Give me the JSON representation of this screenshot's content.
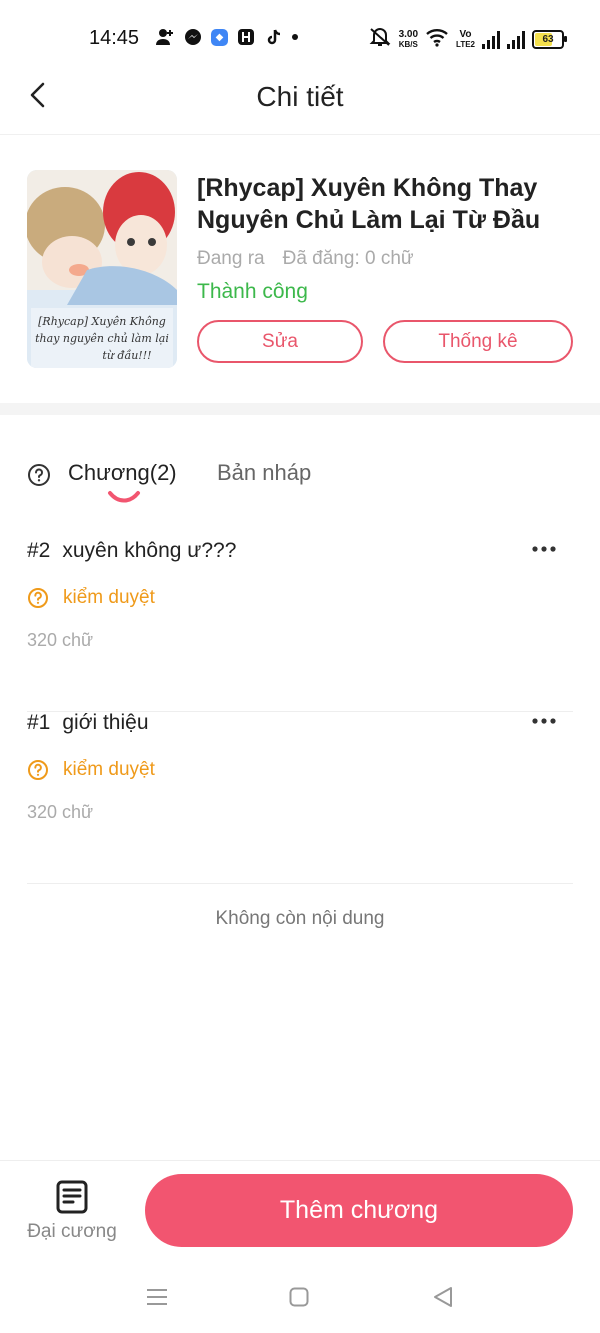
{
  "status_bar": {
    "time": "14:45",
    "net_speed_top": "3.00",
    "net_speed_bottom": "KB/S",
    "volte_top": "Vo",
    "volte_bottom": "LTE2",
    "battery": "63",
    "battery_level": 0.63,
    "icons": [
      "add-user-icon",
      "messenger-icon",
      "app-icon",
      "h-app-icon",
      "tiktok-icon",
      "dot-icon",
      "mute-icon",
      "wifi-icon",
      "signal-icon",
      "signal-icon"
    ]
  },
  "header": {
    "title": "Chi tiết"
  },
  "book": {
    "title": "[Rhycap] Xuyên Không Thay Nguyên Chủ Làm Lại Từ Đầu",
    "status": "Đang ra",
    "posted": "Đã đăng: 0 chữ",
    "result": "Thành công",
    "edit_label": "Sửa",
    "stats_label": "Thống kê",
    "cover_text": [
      "[Rhycap] Xuyên Không",
      "thay nguyên chủ làm lại",
      "từ đầu!!!"
    ]
  },
  "tabs": {
    "chapters": "Chương(2)",
    "drafts": "Bản nháp"
  },
  "chapters": [
    {
      "num": "#2",
      "title": "xuyên không ư???",
      "status": "kiểm duyệt",
      "words": "320 chữ"
    },
    {
      "num": "#1",
      "title": "giới thiệu",
      "status": "kiểm duyệt",
      "words": "320 chữ"
    }
  ],
  "end_text": "Không còn nội dung",
  "bottom": {
    "outline_label": "Đại cương",
    "add_label": "Thêm chương"
  },
  "colors": {
    "accent": "#f25570",
    "success": "#3cb84b",
    "review": "#ef9a1a"
  }
}
